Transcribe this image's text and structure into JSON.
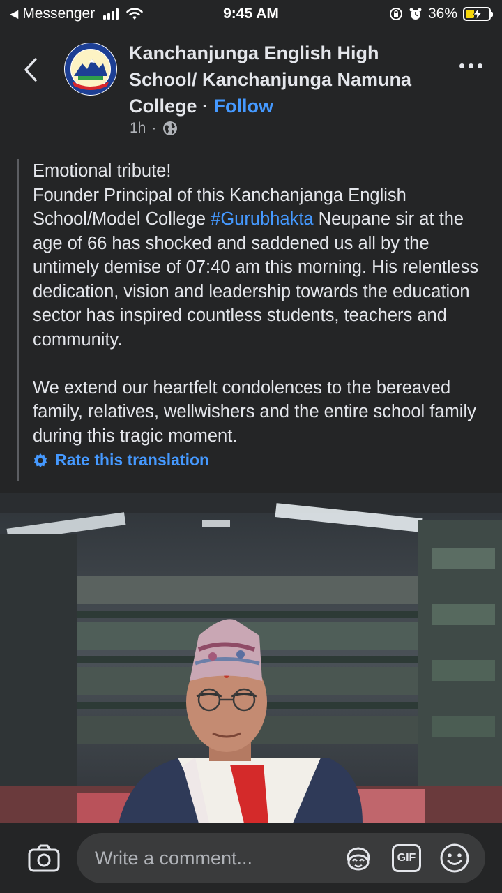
{
  "status_bar": {
    "back_app": "Messenger",
    "time": "9:45 AM",
    "battery_percent": "36%",
    "battery_level": 0.36,
    "icons": [
      "signal-icon",
      "wifi-icon",
      "orientation-lock-icon",
      "alarm-icon",
      "battery-charging-icon"
    ]
  },
  "header": {
    "page_name": "Kanchanjunga English High School/ Kanchanjunga Namuna College",
    "separator": " · ",
    "follow_label": "Follow",
    "time_ago": "1h",
    "meta_dot": "·",
    "privacy_icon": "globe-icon"
  },
  "post": {
    "line1": "Emotional tribute!",
    "para1_before": "Founder Principal of this Kanchanjanga English School/Model College ",
    "hashtag": "#Gurubhakta",
    "para1_after": " Neupane sir at the age of 66 has shocked and saddened us all by the untimely demise of 07:40 am this morning. His relentless dedication, vision and leadership towards the education sector has inspired countless students, teachers and community.",
    "para2": "We extend our heartfelt condolences to the bereaved family, relatives, wellwishers and the entire school family during this tragic moment.",
    "rate_label": "Rate this translation"
  },
  "comment_bar": {
    "placeholder": "Write a comment...",
    "gif_label": "GIF"
  },
  "colors": {
    "background": "#242526",
    "link_blue": "#4599ff",
    "text": "#e4e6eb",
    "muted": "#b0b3b8",
    "input_bg": "#3a3b3c"
  }
}
